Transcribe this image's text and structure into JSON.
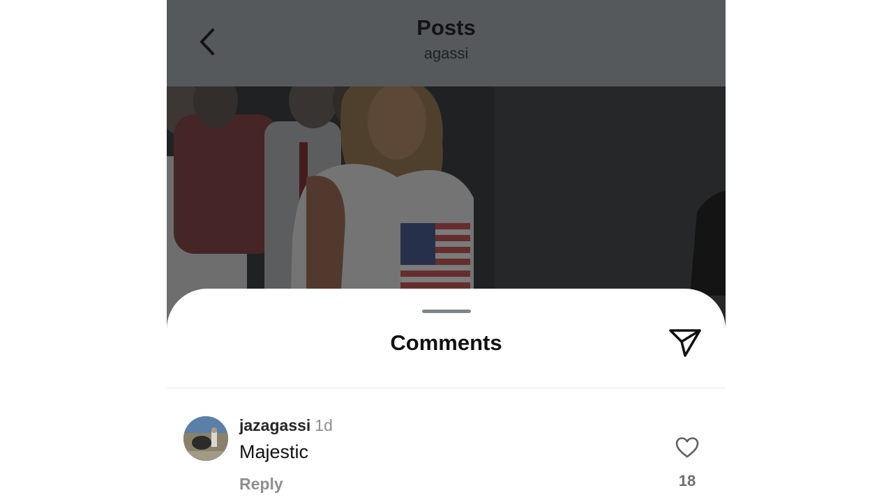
{
  "header": {
    "title": "Posts",
    "subtitle": "agassi",
    "back_icon": "chevron-left-icon"
  },
  "post": {
    "image": "photo of a man with long hair in a sleeveless American flag shirt"
  },
  "comments_sheet": {
    "title": "Comments",
    "send_icon": "paper-plane-icon"
  },
  "comments": [
    {
      "username": "jazagassi",
      "time": "1d",
      "text": "Majestic",
      "reply_label": "Reply",
      "likes": "18",
      "like_icon": "heart-outline-icon"
    }
  ],
  "colors": {
    "header_bg": "#55595c",
    "sheet_bg": "#ffffff",
    "secondary_text": "#8e8e8e"
  }
}
